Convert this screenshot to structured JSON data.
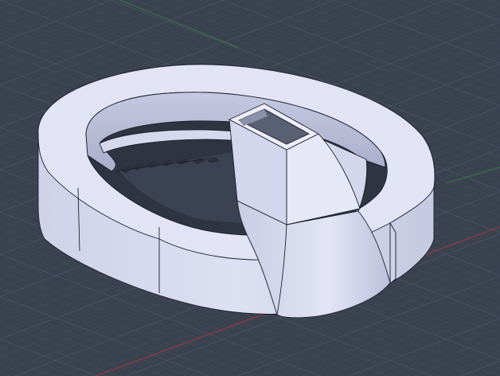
{
  "viewport": {
    "background_color": "#3a4250",
    "grid_minor_color": "#4b5563",
    "grid_major_color": "#5a6474",
    "x_axis_color": "#a23a3a",
    "y_axis_color": "#3e7a3e"
  },
  "model": {
    "face_color": "#dfe1f2",
    "face_shade_color": "#c8cbe2",
    "face_dark_color": "#b3b7d3",
    "edge_color": "#1c1f2a",
    "inner_shadow_color": "#9fa4c4"
  }
}
